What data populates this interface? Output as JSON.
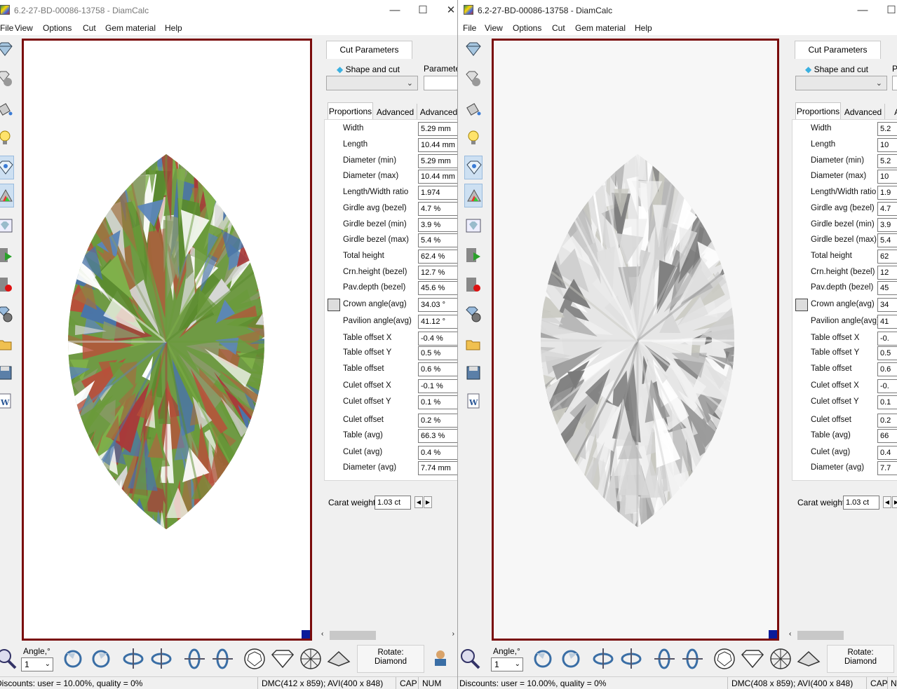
{
  "window_left": {
    "title": "6.2-27-BD-00086-13758 - DiamCalc",
    "menu": [
      "File",
      "View",
      "Options",
      "Cut",
      "Gem material",
      "Help"
    ],
    "tabs": [
      "Cut Parameters"
    ],
    "shape_label": "Shape and cut",
    "parameters_label": "Parameters",
    "prop_tabs": [
      "Proportions",
      "Advanced",
      "Advanced"
    ],
    "properties": [
      {
        "label": "Width",
        "value": "5.29 mm"
      },
      {
        "label": "Length",
        "value": "10.44 mm"
      },
      {
        "label": "Diameter (min)",
        "value": "5.29 mm"
      },
      {
        "label": "Diameter (max)",
        "value": "10.44 mm"
      },
      {
        "label": "Length/Width ratio",
        "value": "1.974"
      },
      {
        "label": "Girdle avg (bezel)",
        "value": "4.7 %"
      },
      {
        "label": "Girdle bezel (min)",
        "value": "3.9 %"
      },
      {
        "label": "Girdle bezel (max)",
        "value": "5.4 %"
      },
      {
        "label": "Total height",
        "value": "62.4 %"
      },
      {
        "label": "Crn.height (bezel)",
        "value": "12.7 %"
      },
      {
        "label": "Pav.depth (bezel)",
        "value": "45.6 %"
      },
      {
        "label": "Crown angle(avg)",
        "value": "34.03 °"
      },
      {
        "label": "Pavilion angle(avg)",
        "value": "41.12 °"
      },
      {
        "label": "Table offset X",
        "value": "-0.4 %"
      },
      {
        "label": "Table offset Y",
        "value": "0.5 %"
      },
      {
        "label": "Table offset",
        "value": "0.6 %"
      },
      {
        "label": "Culet offset X",
        "value": "-0.1 %"
      },
      {
        "label": "Culet offset Y",
        "value": "0.1 %"
      },
      {
        "label": "Culet offset",
        "value": "0.2 %"
      },
      {
        "label": "Table (avg)",
        "value": "66.3 %"
      },
      {
        "label": "Culet (avg)",
        "value": "0.4 %"
      },
      {
        "label": "Diameter (avg)",
        "value": "7.74 mm"
      }
    ],
    "carat_label": "Carat weight",
    "carat_value": "1.03 ct",
    "angle_label": "Angle,°",
    "angle_value": "1",
    "rotate_line1": "Rotate:",
    "rotate_line2": "Diamond",
    "status_discounts": "Discounts: user = 10.00%, quality = 0%",
    "status_dims": "DMC(412 x 859); AVI(400 x 848)",
    "status_cap": "CAP",
    "status_num": "NUM"
  },
  "window_right": {
    "title": "6.2-27-BD-00086-13758 - DiamCalc",
    "menu": [
      "File",
      "View",
      "Options",
      "Cut",
      "Gem material",
      "Help"
    ],
    "tabs": [
      "Cut Parameters"
    ],
    "shape_label": "Shape and cut",
    "parameters_label": "P",
    "prop_tabs": [
      "Proportions",
      "Advanced",
      "Ad"
    ],
    "properties": [
      {
        "label": "Width",
        "value": "5.2"
      },
      {
        "label": "Length",
        "value": "10"
      },
      {
        "label": "Diameter (min)",
        "value": "5.2"
      },
      {
        "label": "Diameter (max)",
        "value": "10"
      },
      {
        "label": "Length/Width ratio",
        "value": "1.9"
      },
      {
        "label": "Girdle avg (bezel)",
        "value": "4.7"
      },
      {
        "label": "Girdle bezel (min)",
        "value": "3.9"
      },
      {
        "label": "Girdle bezel (max)",
        "value": "5.4"
      },
      {
        "label": "Total height",
        "value": "62"
      },
      {
        "label": "Crn.height (bezel)",
        "value": "12"
      },
      {
        "label": "Pav.depth (bezel)",
        "value": "45"
      },
      {
        "label": "Crown angle(avg)",
        "value": "34"
      },
      {
        "label": "Pavilion angle(avg)",
        "value": "41"
      },
      {
        "label": "Table offset X",
        "value": "-0."
      },
      {
        "label": "Table offset Y",
        "value": "0.5"
      },
      {
        "label": "Table offset",
        "value": "0.6"
      },
      {
        "label": "Culet offset X",
        "value": "-0."
      },
      {
        "label": "Culet offset Y",
        "value": "0.1"
      },
      {
        "label": "Culet offset",
        "value": "0.2"
      },
      {
        "label": "Table (avg)",
        "value": "66"
      },
      {
        "label": "Culet (avg)",
        "value": "0.4"
      },
      {
        "label": "Diameter (avg)",
        "value": "7.7"
      }
    ],
    "carat_label": "Carat weight",
    "carat_value": "1.03 ct",
    "angle_label": "Angle,°",
    "angle_value": "1",
    "rotate_line1": "Rotate:",
    "rotate_line2": "Diamond",
    "status_discounts": "Discounts: user = 10.00%, quality = 0%",
    "status_dims": "DMC(408 x 859); AVI(400 x 848)",
    "status_cap": "CAP",
    "status_num": "N"
  },
  "colors": {
    "viewport_border": "#7a0c0c",
    "corner_mark": "#0a1a9a",
    "active_tool": "#cde0f2",
    "gem_green": "#6a9a3a",
    "gem_red": "#a83a3a",
    "gem_blue": "#4a74a8"
  },
  "icons": [
    "diamond-icon",
    "sphere-icon",
    "paint-bucket-icon",
    "lightbulb-icon",
    "gem-view-icon",
    "spectrum-icon",
    "image-icon",
    "film-play-icon",
    "film-record-icon",
    "reel-icon",
    "open-folder-icon",
    "save-icon",
    "word-doc-icon",
    "zoom-icon",
    "rotate-ccw-icon",
    "rotate-cw-icon",
    "flip-vertical-icon",
    "flip-horizontal-icon",
    "tilt-left-icon",
    "tilt-right-icon",
    "top-view-icon",
    "side-view-icon",
    "pavilion-view-icon",
    "profile-view-icon",
    "person-rotate-icon"
  ]
}
